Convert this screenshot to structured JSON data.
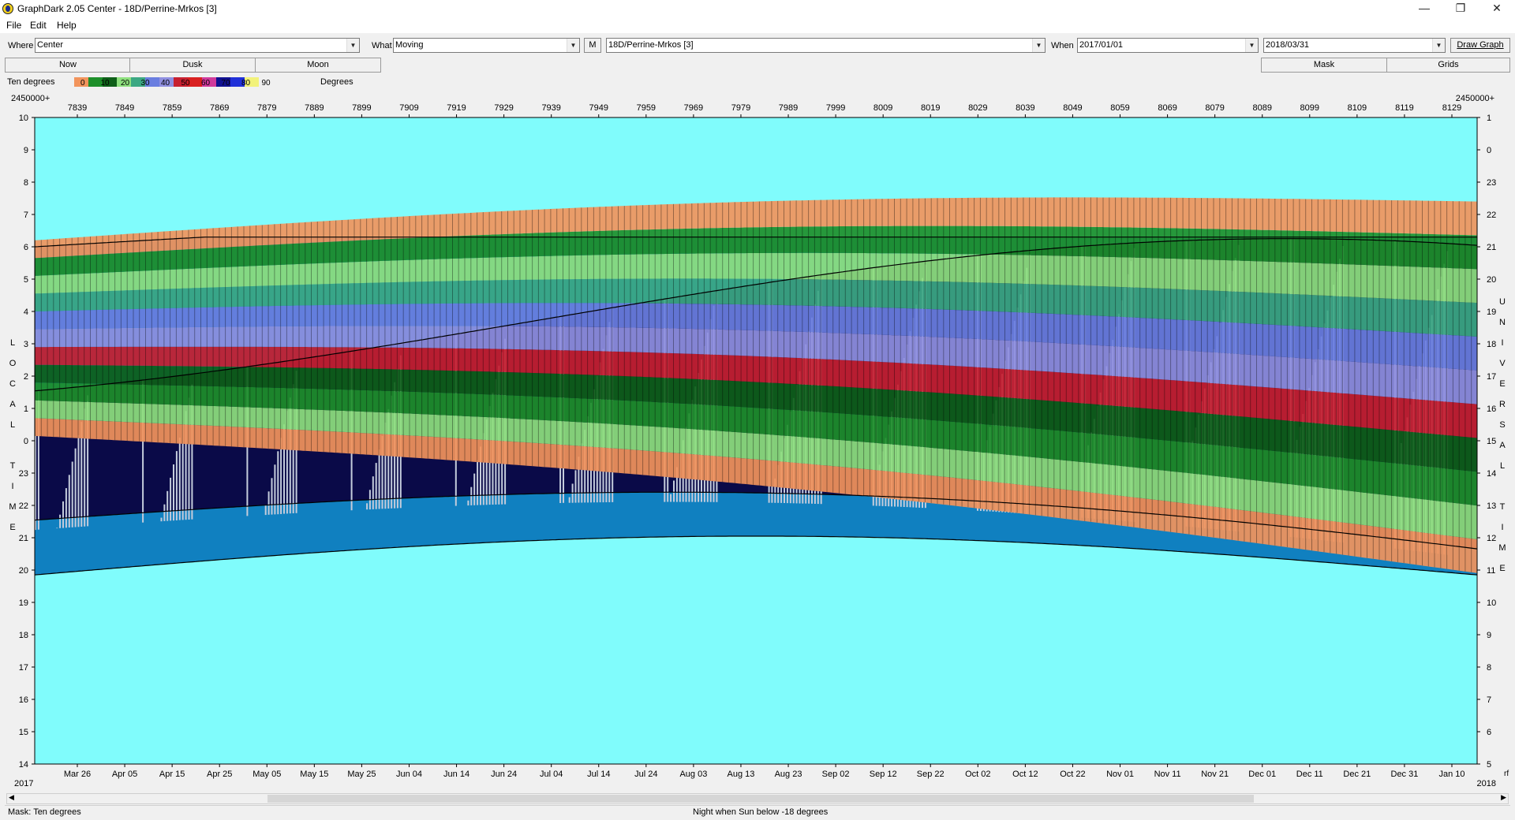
{
  "window": {
    "title": "GraphDark 2.05  Center  -  18D/Perrine-Mrkos [3]",
    "min_glyph": "—",
    "max_glyph": "❐",
    "close_glyph": "✕"
  },
  "menu": {
    "items": [
      "File",
      "Edit",
      "Help"
    ]
  },
  "toolbar": {
    "where_label": "Where",
    "where_value": "Center",
    "what_label": "What",
    "what_value": "Moving",
    "m_button": "M",
    "object_value": "18D/Perrine-Mrkos [3]",
    "when_label": "When",
    "start_date": "2017/01/01",
    "end_date": "2018/03/31",
    "draw_graph": "Draw Graph"
  },
  "buttons": {
    "now": "Now",
    "dusk": "Dusk",
    "moon": "Moon",
    "mask": "Mask",
    "grids": "Grids"
  },
  "legend": {
    "label": "Ten degrees",
    "units": "Degrees",
    "ticks": [
      "0",
      "10",
      "20",
      "30",
      "40",
      "50",
      "60",
      "70",
      "80",
      "90"
    ],
    "colors": [
      "#f2945c",
      "#1e8f2a",
      "#0e5f18",
      "#8ee07e",
      "#3ca883",
      "#6a7ee0",
      "#8f8fe0",
      "#c72030",
      "#d92020",
      "#d03a9c",
      "#101090",
      "#2030d8",
      "#f2f27a"
    ]
  },
  "colors": {
    "sky": "#80fcfc",
    "night": "#0a0a48",
    "moonlit": "#c4ccdc",
    "twilight": "#1080c0"
  },
  "axes": {
    "jd_prefix": "2450000+",
    "jd_ticks": [
      "7839",
      "7849",
      "7859",
      "7869",
      "7879",
      "7889",
      "7899",
      "7909",
      "7919",
      "7929",
      "7939",
      "7949",
      "7959",
      "7969",
      "7979",
      "7989",
      "7999",
      "8009",
      "8019",
      "8029",
      "8039",
      "8049",
      "8059",
      "8069",
      "8079",
      "8089",
      "8099",
      "8109",
      "8119",
      "8129"
    ],
    "date_ticks": [
      "Mar 26",
      "Apr 05",
      "Apr 15",
      "Apr 25",
      "May 05",
      "May 15",
      "May 25",
      "Jun 04",
      "Jun 14",
      "Jun 24",
      "Jul 04",
      "Jul 14",
      "Jul 24",
      "Aug 03",
      "Aug 13",
      "Aug 23",
      "Sep 02",
      "Sep 12",
      "Sep 22",
      "Oct 02",
      "Oct 12",
      "Oct 22",
      "Nov 01",
      "Nov 11",
      "Nov 21",
      "Dec 01",
      "Dec 11",
      "Dec 21",
      "Dec 31",
      "Jan 10"
    ],
    "year_left": "2017",
    "year_right": "2018",
    "local_ticks": [
      "10",
      "9",
      "8",
      "7",
      "6",
      "5",
      "4",
      "3",
      "2",
      "1",
      "0",
      "23",
      "22",
      "21",
      "20",
      "19",
      "18",
      "17",
      "16",
      "15",
      "14"
    ],
    "ut_ticks": [
      "1",
      "0",
      "23",
      "22",
      "21",
      "20",
      "19",
      "18",
      "17",
      "16",
      "15",
      "14",
      "13",
      "12",
      "11",
      "10",
      "9",
      "8",
      "7",
      "6",
      "5"
    ],
    "left_title": [
      "L",
      "O",
      "C",
      "A",
      "L",
      "",
      "T",
      "I",
      "M",
      "E"
    ],
    "right_title": [
      "U",
      "N",
      "I",
      "V",
      "E",
      "R",
      "S",
      "A",
      "L",
      "",
      "T",
      "I",
      "M",
      "E"
    ],
    "right_edge_label": "rf"
  },
  "status": {
    "mask": "Mask:  Ten degrees",
    "night": "Night when Sun below -18 degrees"
  }
}
